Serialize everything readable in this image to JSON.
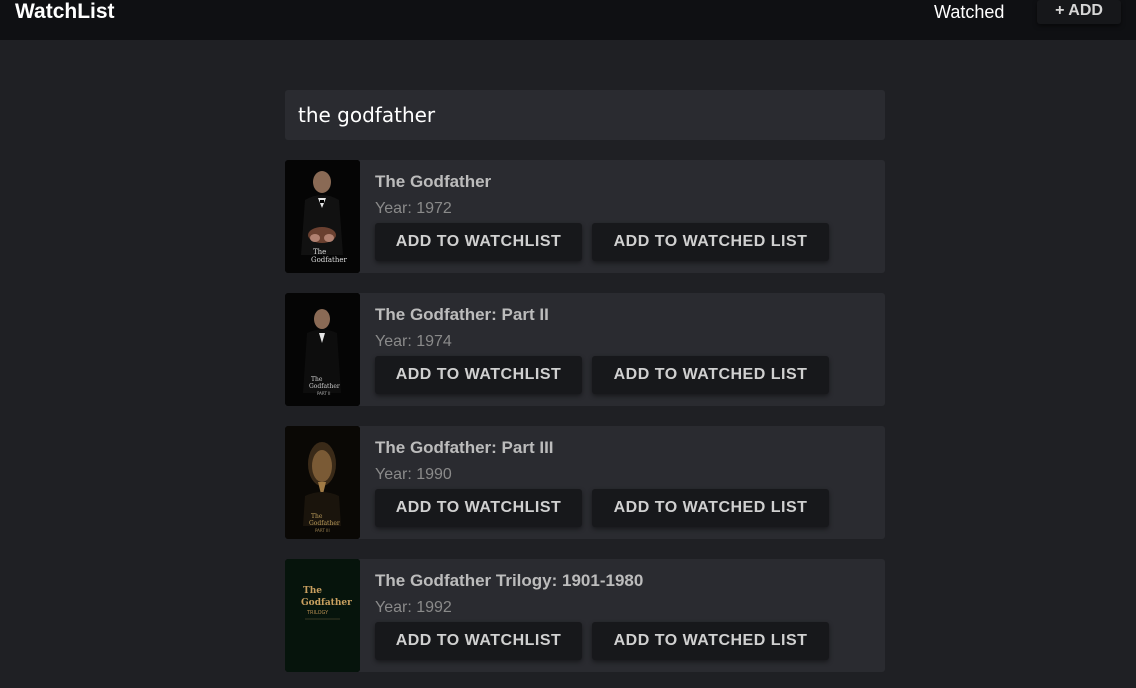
{
  "header": {
    "brand": "WatchList",
    "nav_watched": "Watched",
    "nav_add": "+ ADD"
  },
  "search": {
    "value": "the godfather",
    "placeholder": ""
  },
  "results": [
    {
      "title": "The Godfather",
      "year": "Year: 1972",
      "add_watchlist": "ADD TO WATCHLIST",
      "add_watched": "ADD TO WATCHED LIST",
      "poster_text": "The Godfather"
    },
    {
      "title": "The Godfather: Part II",
      "year": "Year: 1974",
      "add_watchlist": "ADD TO WATCHLIST",
      "add_watched": "ADD TO WATCHED LIST",
      "poster_text": "The Godfather PART II"
    },
    {
      "title": "The Godfather: Part III",
      "year": "Year: 1990",
      "add_watchlist": "ADD TO WATCHLIST",
      "add_watched": "ADD TO WATCHED LIST",
      "poster_text": "The Godfather PART III"
    },
    {
      "title": "The Godfather Trilogy: 1901-1980",
      "year": "Year: 1992",
      "add_watchlist": "ADD TO WATCHLIST",
      "add_watched": "ADD TO WATCHED LIST",
      "poster_text": "The Godfather TRILOGY"
    }
  ],
  "colors": {
    "background": "#1f2024",
    "topbar": "#0f1013",
    "card": "#2a2b30",
    "button": "#17181b"
  }
}
